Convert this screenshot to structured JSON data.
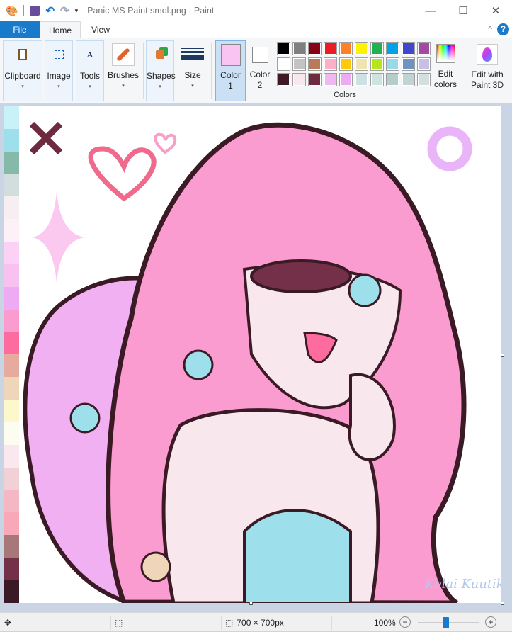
{
  "window": {
    "title": "Panic MS Paint smol.png - Paint",
    "minimize": "—",
    "maximize": "☐",
    "close": "✕"
  },
  "tabs": {
    "file": "File",
    "home": "Home",
    "view": "View"
  },
  "ribbon": {
    "clipboard": "Clipboard",
    "image": "Image",
    "tools": "Tools",
    "brushes": "Brushes",
    "shapes": "Shapes",
    "size": "Size",
    "color1_line1": "Color",
    "color1_line2": "1",
    "color2_line1": "Color",
    "color2_line2": "2",
    "colors_group": "Colors",
    "edit_colors_line1": "Edit",
    "edit_colors_line2": "colors",
    "paint3d_line1": "Edit with",
    "paint3d_line2": "Paint 3D",
    "caret": "▾",
    "help": "?",
    "collapse": "^"
  },
  "colors": {
    "color1": "#f9c3f2",
    "color2": "#ffffff",
    "palette": [
      [
        "#000000",
        "#7f7f7f",
        "#880015",
        "#ed1c24",
        "#ff7f27",
        "#fff200",
        "#22b14c",
        "#00a2e8",
        "#3f48cc",
        "#a349a4"
      ],
      [
        "#ffffff",
        "#c3c3c3",
        "#b97a57",
        "#ffaec9",
        "#ffc90e",
        "#efe4b0",
        "#b5e61d",
        "#99d9ea",
        "#7092be",
        "#c8bfe7"
      ],
      [
        "#3f1a24",
        "#f8e8ee",
        "#6e2a3e",
        "#f0b8f0",
        "#eeaaf2",
        "#cde0e3",
        "#cce3e0",
        "#b5cdca",
        "#c0d4d4",
        "#d3dfdf"
      ]
    ]
  },
  "canvas": {
    "strip_colors": [
      "#c8f2f8",
      "#9de0ec",
      "#86b9a8",
      "#d1dedd",
      "#f6eef0",
      "#fdf1f7",
      "#fbd2f6",
      "#f7c2ef",
      "#eeaaf2",
      "#fb9cd0",
      "#fe6b9e",
      "#e6aa9e",
      "#f0d6b8",
      "#fdf7cc",
      "#fdfcf0",
      "#f9e8ee",
      "#f1d0d6",
      "#f3b8c4",
      "#f8a8b6",
      "#a87878",
      "#743048",
      "#3a1a24"
    ],
    "signature": "Kelai Kuutiko"
  },
  "status": {
    "size": "700 × 700px",
    "zoom": "100%",
    "zoom_fraction": 0.45
  }
}
